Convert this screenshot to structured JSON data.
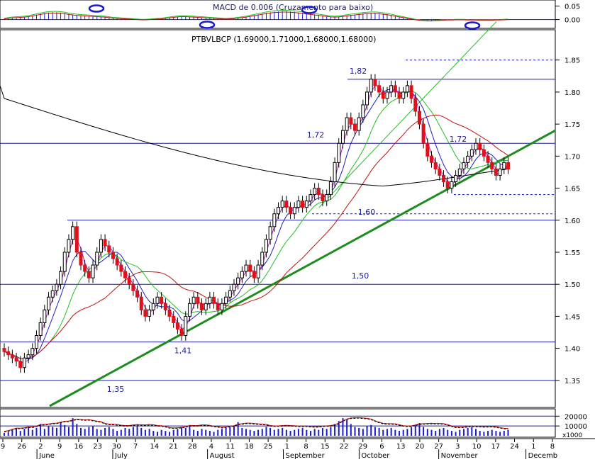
{
  "chart_data": [
    {
      "panel": "macd",
      "type": "histogram",
      "title": "MACD",
      "overlay_text": "MACD de 0.006 (Cruzamento para baixo)",
      "ylim": [
        -0.03,
        0.07
      ],
      "y_ticks": [
        0.05,
        0.0
      ],
      "y_tick_labels": [
        "0.05",
        "0.00"
      ],
      "values": [
        0.003,
        0.005,
        0.007,
        0.008,
        0.009,
        0.01,
        0.012,
        0.015,
        0.018,
        0.021,
        0.024,
        0.026,
        0.027,
        0.027,
        0.026,
        0.024,
        0.021,
        0.019,
        0.017,
        0.016,
        0.015,
        0.014,
        0.013,
        0.012,
        0.011,
        0.01,
        0.008,
        0.006,
        0.005,
        0.004,
        0.003,
        0.002,
        0.001,
        0.0,
        -0.001,
        -0.001,
        0.0,
        0.001,
        0.002,
        0.003,
        0.005,
        0.007,
        0.009,
        0.011,
        0.012,
        0.012,
        0.011,
        0.01,
        0.009,
        0.008,
        0.007,
        0.006,
        0.005,
        0.004,
        0.003,
        0.002,
        0.003,
        0.004,
        0.006,
        0.008,
        0.01,
        0.013,
        0.016,
        0.019,
        0.022,
        0.025,
        0.027,
        0.029,
        0.03,
        0.031,
        0.031,
        0.03,
        0.029,
        0.027,
        0.025,
        0.023,
        0.021,
        0.019,
        0.017,
        0.015,
        0.013,
        0.011,
        0.01,
        0.011,
        0.013,
        0.015,
        0.017,
        0.019,
        0.021,
        0.023,
        0.024,
        0.025,
        0.025,
        0.024,
        0.022,
        0.02,
        0.017,
        0.014,
        0.011,
        0.008,
        0.005,
        0.002,
        -0.001,
        -0.003,
        -0.005,
        -0.006,
        -0.006,
        -0.005,
        -0.004,
        -0.003,
        -0.002,
        -0.002,
        -0.001,
        -0.001,
        -0.001,
        -0.002,
        -0.002,
        -0.002,
        -0.003,
        -0.003,
        -0.003,
        -0.003,
        -0.002,
        -0.002,
        -0.001,
        0.0
      ]
    },
    {
      "panel": "price",
      "type": "candlestick",
      "title": "PTBVLBCP (1.69000,1.71000,1.68000,1.68000)",
      "ylim": [
        1.31,
        1.895
      ],
      "y_ticks": [
        1.35,
        1.4,
        1.45,
        1.5,
        1.55,
        1.6,
        1.65,
        1.7,
        1.75,
        1.8,
        1.85
      ],
      "y_tick_labels": [
        "1.35",
        "1.40",
        "1.45",
        "1.50",
        "1.55",
        "1.60",
        "1.65",
        "1.70",
        "1.75",
        "1.80",
        "1.85"
      ],
      "closes": [
        1.395,
        1.39,
        1.385,
        1.38,
        1.37,
        1.385,
        1.39,
        1.4,
        1.42,
        1.44,
        1.46,
        1.48,
        1.49,
        1.5,
        1.52,
        1.55,
        1.57,
        1.59,
        1.55,
        1.53,
        1.52,
        1.51,
        1.53,
        1.55,
        1.57,
        1.56,
        1.55,
        1.54,
        1.53,
        1.52,
        1.51,
        1.5,
        1.49,
        1.48,
        1.46,
        1.45,
        1.46,
        1.47,
        1.48,
        1.47,
        1.46,
        1.45,
        1.44,
        1.43,
        1.42,
        1.45,
        1.47,
        1.48,
        1.47,
        1.46,
        1.47,
        1.48,
        1.47,
        1.46,
        1.47,
        1.48,
        1.49,
        1.5,
        1.51,
        1.52,
        1.53,
        1.52,
        1.51,
        1.53,
        1.55,
        1.57,
        1.59,
        1.61,
        1.62,
        1.63,
        1.62,
        1.61,
        1.62,
        1.63,
        1.62,
        1.63,
        1.64,
        1.65,
        1.64,
        1.63,
        1.64,
        1.66,
        1.69,
        1.72,
        1.74,
        1.76,
        1.75,
        1.74,
        1.76,
        1.78,
        1.8,
        1.82,
        1.81,
        1.8,
        1.79,
        1.8,
        1.81,
        1.8,
        1.79,
        1.8,
        1.81,
        1.79,
        1.77,
        1.75,
        1.72,
        1.7,
        1.69,
        1.68,
        1.67,
        1.66,
        1.65,
        1.66,
        1.67,
        1.68,
        1.69,
        1.7,
        1.71,
        1.72,
        1.71,
        1.7,
        1.69,
        1.68,
        1.67,
        1.68,
        1.69,
        1.68
      ],
      "opens": [
        1.4,
        1.395,
        1.39,
        1.385,
        1.38,
        1.37,
        1.385,
        1.39,
        1.4,
        1.42,
        1.44,
        1.46,
        1.48,
        1.49,
        1.5,
        1.52,
        1.55,
        1.57,
        1.59,
        1.55,
        1.53,
        1.52,
        1.51,
        1.53,
        1.55,
        1.57,
        1.56,
        1.55,
        1.54,
        1.53,
        1.52,
        1.51,
        1.5,
        1.49,
        1.48,
        1.46,
        1.45,
        1.46,
        1.47,
        1.48,
        1.47,
        1.46,
        1.45,
        1.44,
        1.43,
        1.42,
        1.45,
        1.47,
        1.48,
        1.47,
        1.46,
        1.47,
        1.48,
        1.47,
        1.46,
        1.47,
        1.48,
        1.49,
        1.5,
        1.51,
        1.52,
        1.53,
        1.52,
        1.51,
        1.53,
        1.55,
        1.57,
        1.59,
        1.61,
        1.62,
        1.63,
        1.62,
        1.61,
        1.62,
        1.63,
        1.62,
        1.63,
        1.64,
        1.65,
        1.64,
        1.63,
        1.64,
        1.66,
        1.69,
        1.72,
        1.74,
        1.76,
        1.75,
        1.74,
        1.76,
        1.78,
        1.8,
        1.82,
        1.81,
        1.8,
        1.79,
        1.8,
        1.81,
        1.8,
        1.79,
        1.8,
        1.81,
        1.79,
        1.77,
        1.75,
        1.72,
        1.7,
        1.69,
        1.68,
        1.67,
        1.66,
        1.65,
        1.66,
        1.67,
        1.68,
        1.69,
        1.7,
        1.71,
        1.72,
        1.71,
        1.7,
        1.69,
        1.68,
        1.67,
        1.68,
        1.69
      ],
      "support_levels": [
        {
          "value": 1.82,
          "label": "1,82"
        },
        {
          "value": 1.72,
          "label": "1,72"
        },
        {
          "value": 1.6,
          "label": "1,60"
        },
        {
          "value": 1.5,
          "label": "1,50"
        },
        {
          "value": 1.41,
          "label": "1,41"
        },
        {
          "value": 1.35,
          "label": "1,35"
        }
      ],
      "dotted_levels": [
        1.85,
        1.64,
        1.61
      ],
      "extra_label": "1,72",
      "trendline": {
        "from": [
          1.31
        ],
        "to": [
          1.74
        ]
      },
      "trend_color": "#1e8c1e"
    },
    {
      "panel": "volume",
      "type": "bar",
      "ylim": [
        0,
        26000
      ],
      "y_ticks": [
        20000,
        10000
      ],
      "y_tick_labels": [
        "20000",
        "10000"
      ],
      "unit_label": "x1000",
      "values": [
        3000,
        4000,
        6000,
        8000,
        5000,
        7000,
        9000,
        6000,
        8000,
        12000,
        7000,
        10000,
        9000,
        8000,
        14000,
        11000,
        9000,
        18000,
        12000,
        8000,
        7000,
        9000,
        10000,
        7000,
        6000,
        8000,
        9000,
        7000,
        5000,
        6000,
        8000,
        7000,
        9000,
        10000,
        8000,
        6000,
        7000,
        5000,
        4000,
        6000,
        5000,
        4000,
        6000,
        7000,
        9000,
        8000,
        11000,
        6000,
        5000,
        7000,
        6000,
        5000,
        4000,
        6000,
        7000,
        8000,
        9000,
        10000,
        14000,
        8000,
        7000,
        6000,
        5000,
        6000,
        7000,
        9000,
        8000,
        6000,
        7000,
        8000,
        6000,
        5000,
        6000,
        7000,
        8000,
        6000,
        5000,
        7000,
        6000,
        8000,
        7000,
        9000,
        12000,
        15000,
        18000,
        16000,
        12000,
        9000,
        8000,
        7000,
        10000,
        11000,
        9000,
        8000,
        6000,
        7000,
        8000,
        6000,
        5000,
        6000,
        7000,
        9000,
        11000,
        13000,
        9000,
        7000,
        6000,
        5000,
        7000,
        8000,
        6000,
        5000,
        4000,
        6000,
        7000,
        8000,
        9000,
        7000,
        5000,
        4000,
        5000,
        6000,
        5000,
        4000,
        5000,
        6000
      ]
    }
  ],
  "x_axis": {
    "day_labels": [
      "9",
      "26",
      "2",
      "9",
      "16",
      "23",
      "30",
      "7",
      "14",
      "21",
      "28",
      "4",
      "11",
      "18",
      "25",
      "1",
      "8",
      "15",
      "22",
      "29",
      "6",
      "13",
      "20",
      "27",
      "3",
      "10",
      "17",
      "24",
      "1",
      "8"
    ],
    "month_labels": [
      "June",
      "July",
      "August",
      "September",
      "October",
      "November",
      "Decemb"
    ]
  },
  "colors": {
    "up": "#000000",
    "down": "#e0101a",
    "level_line": "#1a1aa0",
    "ma_blue": "#2020c0",
    "ma_magenta": "#c020c0",
    "ma_green": "#20c020",
    "ma_red": "#c01010",
    "ma_black": "#000000",
    "volume_bar": "#1a1ad0",
    "volume_red_ma": "#c01010",
    "highlight": "#1a1ad0"
  }
}
